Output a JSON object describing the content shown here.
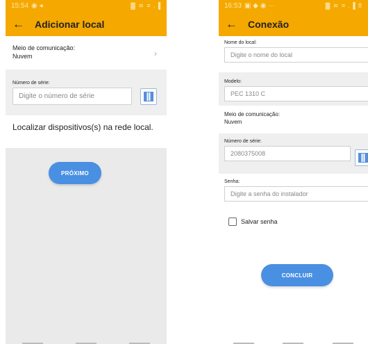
{
  "left": {
    "status_time": "15:54",
    "status_icons": "◉ ◂",
    "status_right": "▓ ≋ ≡ .▐",
    "title": "Adicionar local",
    "medium_label": "Meio de comunicação:",
    "medium_value": "Nuvem",
    "serial_label": "Número de série:",
    "serial_placeholder": "Digite o número de série",
    "local_text": "Localizar dispositivos(s) na rede local.",
    "next_button": "PRÓXIMO"
  },
  "right": {
    "status_time": "16:53",
    "status_icons": "▣ ◆ ◉ ···",
    "status_right": "▓ ≋ ≡ .▐ 8",
    "title": "Conexão",
    "name_label": "Nome do local:",
    "name_placeholder": "Digite o nome do local",
    "model_label": "Modelo:",
    "model_value": "PEC 1310 C",
    "medium_label": "Meio de comunicação:",
    "medium_value": "Nuvem",
    "serial_label": "Número de série:",
    "serial_value": "2080375008",
    "password_label": "Senha:",
    "password_placeholder": "Digite a senha do instalador",
    "save_password": "Salvar senha",
    "finish_button": "CONCLUIR"
  },
  "colors": {
    "accent": "#f5a800",
    "button": "#4a90e2",
    "background": "#efefef"
  },
  "icons": {
    "back": "arrow-left-icon",
    "chevron": "chevron-right-icon",
    "qr": "qr-code-icon"
  }
}
